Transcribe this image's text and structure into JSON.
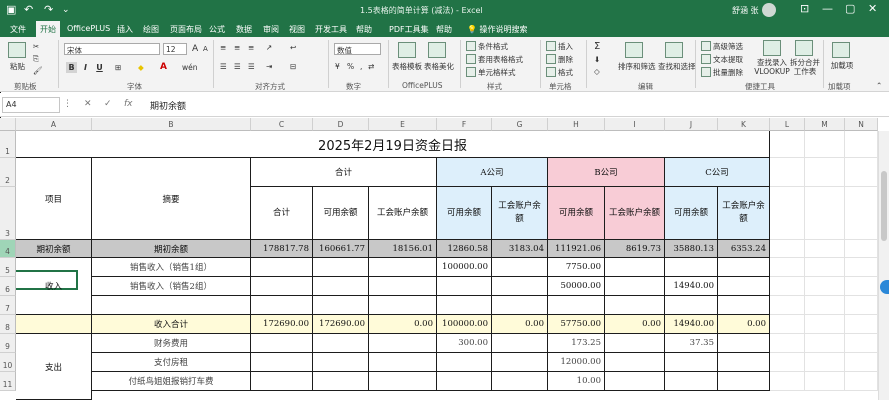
{
  "titlebar": {
    "doc_title": "1.5表格的简单计算 (减法) - Excel",
    "user": "舒涵 张",
    "undo": "↶",
    "redo": "↷",
    "minimize": "—",
    "restore": "▢",
    "close": "✕"
  },
  "tabs": [
    "文件",
    "开始",
    "OfficePLUS",
    "插入",
    "绘图",
    "页面布局",
    "公式",
    "数据",
    "审阅",
    "视图",
    "开发工具",
    "帮助",
    "PDF工具集",
    "帮助"
  ],
  "tell_me": "操作说明搜索",
  "ribbon": {
    "clipboard": {
      "label": "剪贴板",
      "paste": "粘贴"
    },
    "font": {
      "label": "字体",
      "name": "宋体",
      "size": "12",
      "grow": "A",
      "shrink": "A",
      "bold": "B",
      "italic": "I",
      "underline": "U",
      "wen": "wén"
    },
    "alignment": {
      "label": "对齐方式"
    },
    "number": {
      "label": "数字",
      "format": "数值",
      "percent": "%"
    },
    "officeplus": {
      "label": "OfficePLUS",
      "template": "表格模板",
      "beautify": "表格美化"
    },
    "styles": {
      "label": "样式",
      "conditional": "条件格式",
      "table_format": "套用表格格式",
      "cell_styles": "单元格样式"
    },
    "cells": {
      "label": "单元格",
      "insert": "插入",
      "delete": "删除",
      "format": "格式"
    },
    "editing": {
      "label": "编辑",
      "sum": "Σ",
      "sort": "排序和筛选",
      "find": "查找和选择"
    },
    "tools": {
      "label": "便捷工具",
      "advanced_filter": "高级筛选",
      "text_process": "文本提取",
      "batch_delete": "批量删除",
      "lookup": "查找录入VLOOKUP",
      "split_merge": "拆分合并工作表"
    },
    "addins": {
      "label": "加载项",
      "load": "加载项"
    }
  },
  "formula_bar": {
    "name_box": "A4",
    "cancel": "✕",
    "confirm": "✓",
    "fx": "fx",
    "content": "期初余额"
  },
  "columns": [
    "A",
    "B",
    "C",
    "D",
    "E",
    "F",
    "G",
    "H",
    "I",
    "J",
    "K",
    "L",
    "M",
    "N"
  ],
  "rows": [
    "1",
    "2",
    "3",
    "4",
    "5",
    "6",
    "7",
    "8",
    "9",
    "10",
    "11"
  ],
  "sheet": {
    "title": "2025年2月19日资金日报",
    "headers": {
      "item": "项目",
      "summary": "摘要",
      "total": "合计",
      "company_a": "A公司",
      "company_b": "B公司",
      "company_c": "C公司",
      "sub_total": "合计",
      "sub_available": "可用余额",
      "sub_icbc": "工会账户余额"
    },
    "opening": {
      "label": "期初余额",
      "summary": "期初余额",
      "values": [
        "178817.78",
        "160661.77",
        "18156.01",
        "12860.58",
        "3183.04",
        "111921.06",
        "8619.73",
        "35880.13",
        "6353.24"
      ]
    },
    "income": {
      "label": "收入",
      "rows": [
        {
          "summary": "销售收入（销售1组）",
          "values": [
            "",
            "",
            "",
            "100000.00",
            "",
            "7750.00",
            "",
            "",
            ""
          ]
        },
        {
          "summary": "销售收入（销售2组）",
          "values": [
            "",
            "",
            "",
            "",
            "",
            "50000.00",
            "",
            "14940.00",
            ""
          ]
        },
        {
          "summary": "",
          "values": [
            "",
            "",
            "",
            "",
            "",
            "",
            "",
            "",
            ""
          ]
        }
      ],
      "subtotal": {
        "summary": "收入合计",
        "values": [
          "172690.00",
          "172690.00",
          "0.00",
          "100000.00",
          "0.00",
          "57750.00",
          "0.00",
          "14940.00",
          "0.00"
        ]
      }
    },
    "expense": {
      "label": "支出",
      "rows": [
        {
          "summary": "财务费用",
          "values": [
            "",
            "",
            "",
            "300.00",
            "",
            "173.25",
            "",
            "37.35",
            ""
          ]
        },
        {
          "summary": "支付房租",
          "values": [
            "",
            "",
            "",
            "",
            "",
            "12000.00",
            "",
            "",
            ""
          ]
        },
        {
          "summary": "付纸鸟姐姐报销打车费",
          "values": [
            "",
            "",
            "",
            "",
            "",
            "10.00",
            "",
            "",
            ""
          ]
        }
      ]
    }
  },
  "colors": {
    "accent": "#217346",
    "header_blue": "#ddeffb",
    "header_pink": "#f8ccd6",
    "row_gray": "#c8c8c8",
    "subtotal_yellow": "#fffbd9"
  }
}
